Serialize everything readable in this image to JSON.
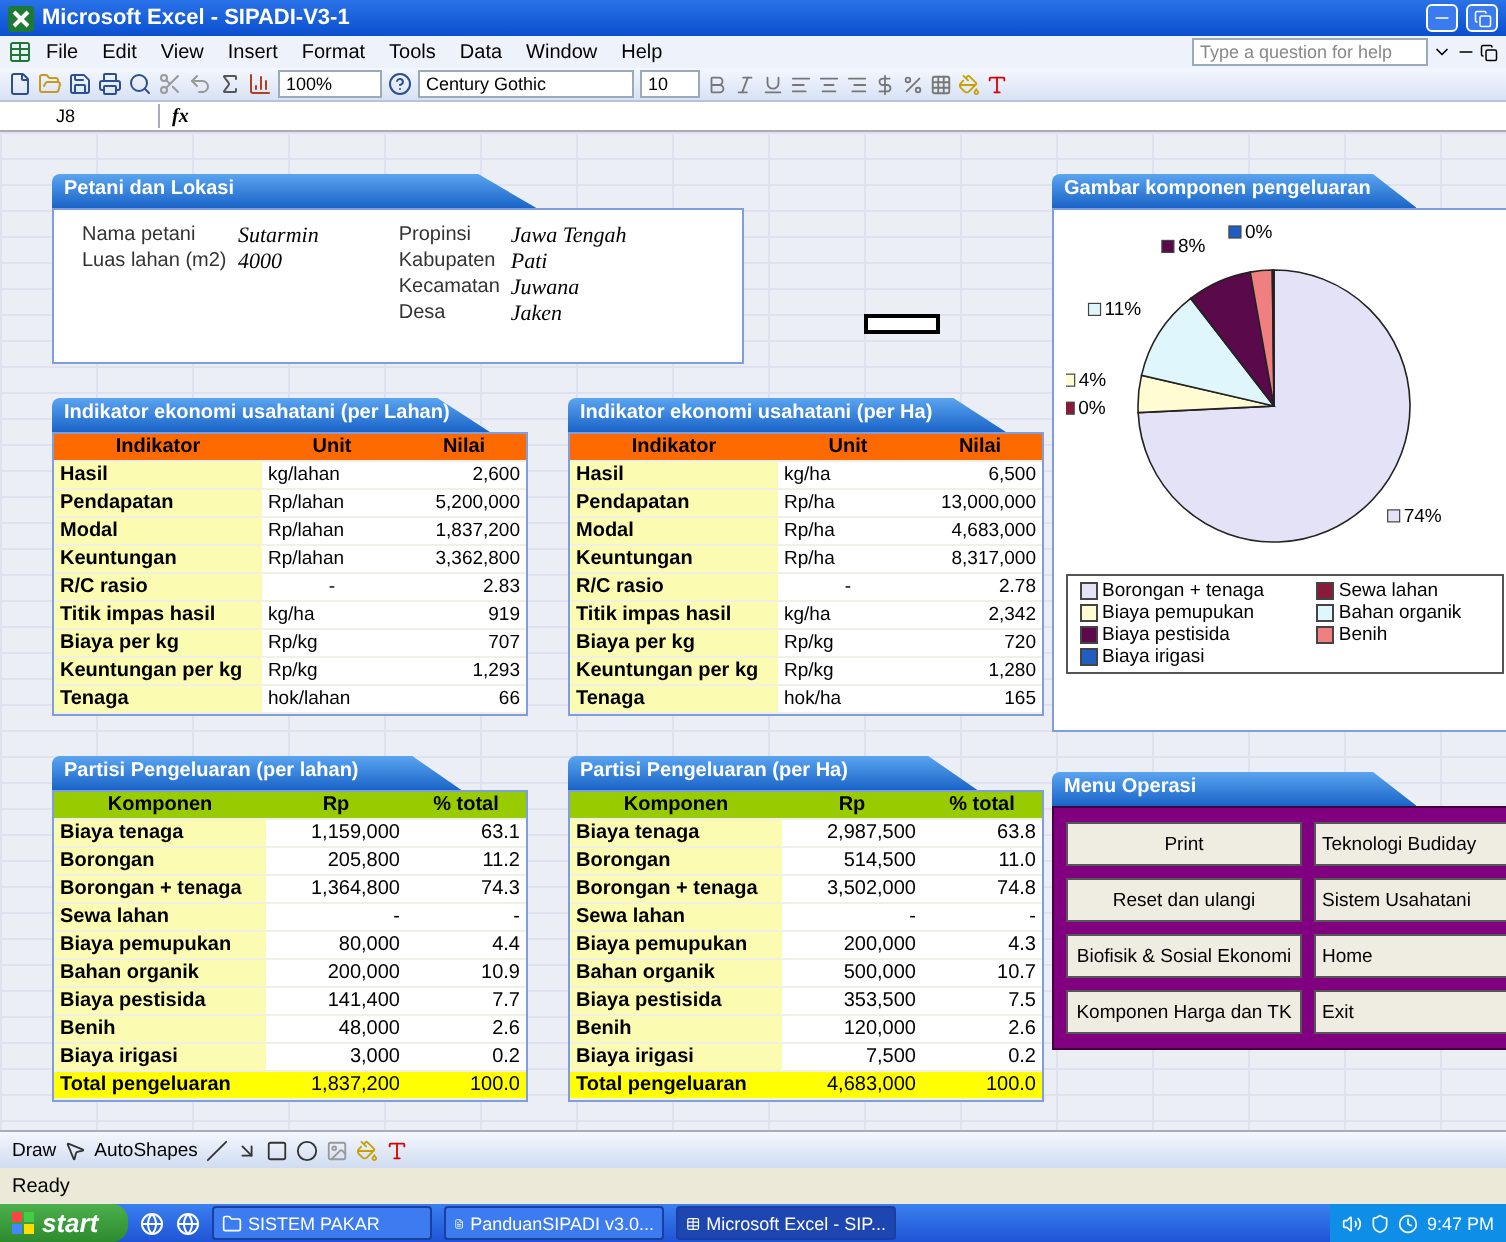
{
  "window": {
    "title": "Microsoft Excel - SIPADI-V3-1"
  },
  "menu": [
    "File",
    "Edit",
    "View",
    "Insert",
    "Format",
    "Tools",
    "Data",
    "Window",
    "Help"
  ],
  "help_box": {
    "placeholder": "Type a question for help"
  },
  "toolbar": {
    "zoom": "100%",
    "font": "Century Gothic",
    "font_size": "10"
  },
  "formula_bar": {
    "cell": "J8",
    "fx": "fx"
  },
  "farmer_panel": {
    "title": "Petani dan Lokasi",
    "left": [
      {
        "label": "Nama petani",
        "value": "Sutarmin"
      },
      {
        "label": "Luas lahan (m2)",
        "value": "4000"
      }
    ],
    "right": [
      {
        "label": "Propinsi",
        "value": "Jawa Tengah"
      },
      {
        "label": "Kabupaten",
        "value": "Pati"
      },
      {
        "label": "Kecamatan",
        "value": "Juwana"
      },
      {
        "label": "Desa",
        "value": "Jaken"
      }
    ]
  },
  "indicator_tables": [
    {
      "title": "Indikator ekonomi usahatani (per Lahan)",
      "columns": [
        "Indikator",
        "Unit",
        "Nilai"
      ],
      "rows": [
        [
          "Hasil",
          "kg/lahan",
          "2,600"
        ],
        [
          "Pendapatan",
          "Rp/lahan",
          "5,200,000"
        ],
        [
          "Modal",
          "Rp/lahan",
          "1,837,200"
        ],
        [
          "Keuntungan",
          "Rp/lahan",
          "3,362,800"
        ],
        [
          "R/C rasio",
          "-",
          "2.83"
        ],
        [
          "Titik impas hasil",
          "kg/ha",
          "919"
        ],
        [
          "Biaya per kg",
          "Rp/kg",
          "707"
        ],
        [
          "Keuntungan per kg",
          "Rp/kg",
          "1,293"
        ],
        [
          "Tenaga",
          "hok/lahan",
          "66"
        ]
      ]
    },
    {
      "title": "Indikator ekonomi usahatani (per Ha)",
      "columns": [
        "Indikator",
        "Unit",
        "Nilai"
      ],
      "rows": [
        [
          "Hasil",
          "kg/ha",
          "6,500"
        ],
        [
          "Pendapatan",
          "Rp/ha",
          "13,000,000"
        ],
        [
          "Modal",
          "Rp/ha",
          "4,683,000"
        ],
        [
          "Keuntungan",
          "Rp/ha",
          "8,317,000"
        ],
        [
          "R/C rasio",
          "-",
          "2.78"
        ],
        [
          "Titik impas hasil",
          "kg/ha",
          "2,342"
        ],
        [
          "Biaya per kg",
          "Rp/kg",
          "720"
        ],
        [
          "Keuntungan per kg",
          "Rp/kg",
          "1,280"
        ],
        [
          "Tenaga",
          "hok/ha",
          "165"
        ]
      ]
    }
  ],
  "expense_tables": [
    {
      "title": "Partisi Pengeluaran (per lahan)",
      "columns": [
        "Komponen",
        "Rp",
        "% total"
      ],
      "rows": [
        [
          "Biaya tenaga",
          "1,159,000",
          "63.1"
        ],
        [
          "Borongan",
          "205,800",
          "11.2"
        ],
        [
          "Borongan + tenaga",
          "1,364,800",
          "74.3"
        ],
        [
          "Sewa lahan",
          "-",
          "-"
        ],
        [
          "Biaya pemupukan",
          "80,000",
          "4.4"
        ],
        [
          "Bahan organik",
          "200,000",
          "10.9"
        ],
        [
          "Biaya pestisida",
          "141,400",
          "7.7"
        ],
        [
          "Benih",
          "48,000",
          "2.6"
        ],
        [
          "Biaya irigasi",
          "3,000",
          "0.2"
        ]
      ],
      "total": [
        "Total pengeluaran",
        "1,837,200",
        "100.0"
      ]
    },
    {
      "title": "Partisi Pengeluaran (per Ha)",
      "columns": [
        "Komponen",
        "Rp",
        "% total"
      ],
      "rows": [
        [
          "Biaya tenaga",
          "2,987,500",
          "63.8"
        ],
        [
          "Borongan",
          "514,500",
          "11.0"
        ],
        [
          "Borongan + tenaga",
          "3,502,000",
          "74.8"
        ],
        [
          "Sewa lahan",
          "-",
          "-"
        ],
        [
          "Biaya pemupukan",
          "200,000",
          "4.3"
        ],
        [
          "Bahan organik",
          "500,000",
          "10.7"
        ],
        [
          "Biaya pestisida",
          "353,500",
          "7.5"
        ],
        [
          "Benih",
          "120,000",
          "2.6"
        ],
        [
          "Biaya irigasi",
          "7,500",
          "0.2"
        ]
      ],
      "total": [
        "Total pengeluaran",
        "4,683,000",
        "100.0"
      ]
    }
  ],
  "chart_panel": {
    "title": "Gambar komponen pengeluaran",
    "chart_data": {
      "type": "pie",
      "categories": [
        "Borongan + tenaga",
        "Sewa lahan",
        "Biaya pemupukan",
        "Bahan organik",
        "Biaya pestisida",
        "Benih",
        "Biaya irigasi"
      ],
      "values": [
        74.3,
        0,
        4.4,
        10.9,
        7.7,
        2.6,
        0.2
      ],
      "colors": [
        "#e4e2f6",
        "#8b1a3a",
        "#fffbd2",
        "#dff7fc",
        "#5a0a4a",
        "#f08080",
        "#1f5fbf"
      ],
      "value_labels": [
        "74%",
        "0%",
        "4%",
        "11%",
        "8%",
        null,
        "0%"
      ]
    }
  },
  "menu_panel": {
    "title": "Menu Operasi",
    "buttons": [
      "Print",
      "Teknologi Budiday",
      "Reset dan ulangi",
      "Sistem Usahatani",
      "Biofisik & Sosial Ekonomi",
      "Home",
      "Komponen Harga dan TK",
      "Exit"
    ]
  },
  "draw_toolbar": {
    "draw": "Draw",
    "autoshapes": "AutoShapes"
  },
  "status_bar": "Ready",
  "taskbar": {
    "start": "start",
    "tasks": [
      {
        "label": "SISTEM PAKAR",
        "selected": false
      },
      {
        "label": "PanduanSIPADI v3.0...",
        "selected": false
      },
      {
        "label": "Microsoft Excel - SIP...",
        "selected": true
      }
    ],
    "clock": "9:47 PM"
  }
}
